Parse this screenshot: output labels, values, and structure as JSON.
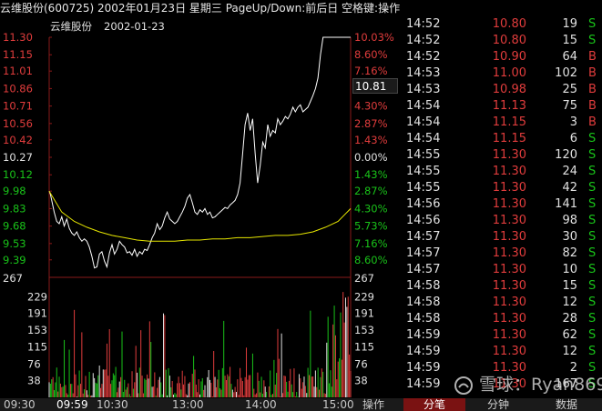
{
  "header": {
    "title": "云维股份(600725) 2002年01月23日 星期三 PageUp/Down:前后日 空格键:操作"
  },
  "chart": {
    "legend_name": "云维股份",
    "legend_date": "2002-01-23",
    "current_value": "10.81",
    "colors": {
      "up": "#e03c3c",
      "down": "#19c219",
      "flat": "#e0e0e0",
      "price_line": "#ffffff",
      "avg_line": "#e6e600",
      "grid": "#7a1a1a",
      "axis": "#8a1a1a"
    }
  },
  "chart_data": {
    "type": "line",
    "title": "",
    "prev_close": 10.27,
    "ylim": [
      9.24,
      11.3
    ],
    "price_ticks": [
      "11.30",
      "11.15",
      "11.01",
      "10.86",
      "10.71",
      "10.56",
      "10.42",
      "10.27",
      "10.12",
      "9.98",
      "9.83",
      "9.68",
      "9.53",
      "9.39"
    ],
    "pct_ticks": [
      "10.03%",
      "8.60%",
      "7.16%",
      "5.73%",
      "4.30%",
      "2.87%",
      "1.43%",
      "0.00%",
      "1.43%",
      "2.87%",
      "4.30%",
      "5.73%",
      "7.16%",
      "8.60%"
    ],
    "volume_ticks": [
      "267",
      "229",
      "191",
      "153",
      "115",
      "76",
      "38"
    ],
    "volume_top_left": "267",
    "volume_top_right": "267",
    "x_labels": [
      "09:30",
      "09:59",
      "10:30",
      "13:00",
      "14:00",
      "15:00"
    ],
    "series": [
      {
        "x": [
          0,
          1,
          2,
          4,
          6,
          8,
          10,
          12,
          14,
          16,
          18,
          20,
          22,
          24,
          26,
          28,
          30,
          32,
          34,
          36,
          38,
          40,
          42,
          44,
          46,
          48,
          50,
          52,
          54,
          56,
          58,
          60,
          62,
          64,
          66,
          68,
          70,
          72,
          74,
          76,
          78,
          80,
          82,
          84,
          86,
          88,
          90,
          92,
          94,
          96,
          98,
          100,
          102,
          104,
          106,
          108,
          110,
          112,
          114,
          116,
          118,
          120,
          122,
          124,
          126,
          128,
          130,
          132,
          134,
          136,
          138,
          140,
          142,
          144,
          146,
          148,
          150,
          152,
          154,
          156,
          158,
          160,
          162,
          164,
          166,
          168,
          170,
          172,
          174,
          176,
          178,
          180,
          182,
          184,
          186,
          188,
          190,
          192,
          194,
          196,
          198,
          200,
          202,
          204,
          206,
          208,
          210,
          212,
          214,
          216,
          218,
          220,
          222,
          224,
          226,
          228,
          230,
          232,
          234,
          236,
          238,
          240
        ],
        "values": [
          9.98,
          9.95,
          9.9,
          9.8,
          9.72,
          9.7,
          9.76,
          9.68,
          9.74,
          9.66,
          9.62,
          9.6,
          9.63,
          9.58,
          9.55,
          9.57,
          9.55,
          9.5,
          9.42,
          9.32,
          9.33,
          9.44,
          9.46,
          9.38,
          9.33,
          9.45,
          9.52,
          9.44,
          9.48,
          9.55,
          9.52,
          9.5,
          9.45,
          9.46,
          9.43,
          9.48,
          9.42,
          9.46,
          9.44,
          9.48,
          9.47,
          9.52,
          9.58,
          9.62,
          9.7,
          9.65,
          9.68,
          9.75,
          9.8,
          9.74,
          9.72,
          9.7,
          9.72,
          9.76,
          9.8,
          9.85,
          9.92,
          9.95,
          9.88,
          9.8,
          9.78,
          9.82,
          9.8,
          9.83,
          9.78,
          9.8,
          9.75,
          9.76,
          9.78,
          9.8,
          9.82,
          9.84,
          9.83,
          9.86,
          9.88,
          9.9,
          9.95,
          10.05,
          10.3,
          10.55,
          10.65,
          10.5,
          10.6,
          10.3,
          10.05,
          10.2,
          10.4,
          10.35,
          10.55,
          10.45,
          10.5,
          10.48,
          10.6,
          10.55,
          10.58,
          10.62,
          10.6,
          10.64,
          10.7,
          10.66,
          10.7,
          10.72,
          10.66,
          10.68,
          10.7,
          10.75,
          10.8,
          10.86,
          10.95,
          11.15,
          11.3,
          11.3,
          11.3,
          11.3,
          11.3,
          11.3,
          11.3,
          11.3,
          11.3,
          11.3,
          11.3,
          11.3
        ]
      },
      {
        "x": [
          0,
          10,
          20,
          30,
          40,
          50,
          60,
          70,
          80,
          90,
          100,
          110,
          120,
          130,
          140,
          150,
          160,
          170,
          180,
          190,
          200,
          210,
          220,
          230,
          240
        ],
        "values": [
          9.98,
          9.8,
          9.72,
          9.67,
          9.63,
          9.6,
          9.58,
          9.56,
          9.55,
          9.55,
          9.55,
          9.56,
          9.56,
          9.57,
          9.57,
          9.58,
          9.58,
          9.59,
          9.6,
          9.6,
          9.61,
          9.63,
          9.67,
          9.72,
          9.83
        ]
      }
    ]
  },
  "ticks": [
    {
      "time": "14:52",
      "price": "10.80",
      "volume": "19",
      "side": "S"
    },
    {
      "time": "14:52",
      "price": "10.80",
      "volume": "15",
      "side": "S"
    },
    {
      "time": "14:52",
      "price": "10.90",
      "volume": "64",
      "side": "B"
    },
    {
      "time": "14:53",
      "price": "11.00",
      "volume": "102",
      "side": "B"
    },
    {
      "time": "14:53",
      "price": "10.98",
      "volume": "25",
      "side": "B"
    },
    {
      "time": "14:54",
      "price": "11.13",
      "volume": "75",
      "side": "B"
    },
    {
      "time": "14:54",
      "price": "11.15",
      "volume": "3",
      "side": "B"
    },
    {
      "time": "14:54",
      "price": "11.15",
      "volume": "6",
      "side": "S"
    },
    {
      "time": "14:55",
      "price": "11.30",
      "volume": "120",
      "side": "S"
    },
    {
      "time": "14:55",
      "price": "11.30",
      "volume": "24",
      "side": "S"
    },
    {
      "time": "14:55",
      "price": "11.30",
      "volume": "42",
      "side": "S"
    },
    {
      "time": "14:56",
      "price": "11.30",
      "volume": "141",
      "side": "S"
    },
    {
      "time": "14:56",
      "price": "11.30",
      "volume": "98",
      "side": "S"
    },
    {
      "time": "14:57",
      "price": "11.30",
      "volume": "30",
      "side": "S"
    },
    {
      "time": "14:57",
      "price": "11.30",
      "volume": "82",
      "side": "S"
    },
    {
      "time": "14:57",
      "price": "11.30",
      "volume": "10",
      "side": "S"
    },
    {
      "time": "14:58",
      "price": "11.30",
      "volume": "15",
      "side": "S"
    },
    {
      "time": "14:58",
      "price": "11.30",
      "volume": "12",
      "side": "S"
    },
    {
      "time": "14:58",
      "price": "11.30",
      "volume": "28",
      "side": "S"
    },
    {
      "time": "14:59",
      "price": "11.30",
      "volume": "62",
      "side": "S"
    },
    {
      "time": "14:59",
      "price": "11.30",
      "volume": "12",
      "side": "S"
    },
    {
      "time": "14:59",
      "price": "11.30",
      "volume": "2",
      "side": "S"
    },
    {
      "time": "14:59",
      "price": "11.30",
      "volume": "167",
      "side": "S"
    }
  ],
  "bottombar": {
    "label_op": "操作",
    "tab_fenbi": "分笔",
    "tab_fenzhong": "分钟",
    "tab_shuju": "数据"
  },
  "watermark": {
    "text": "雪球：Ryan8699"
  }
}
